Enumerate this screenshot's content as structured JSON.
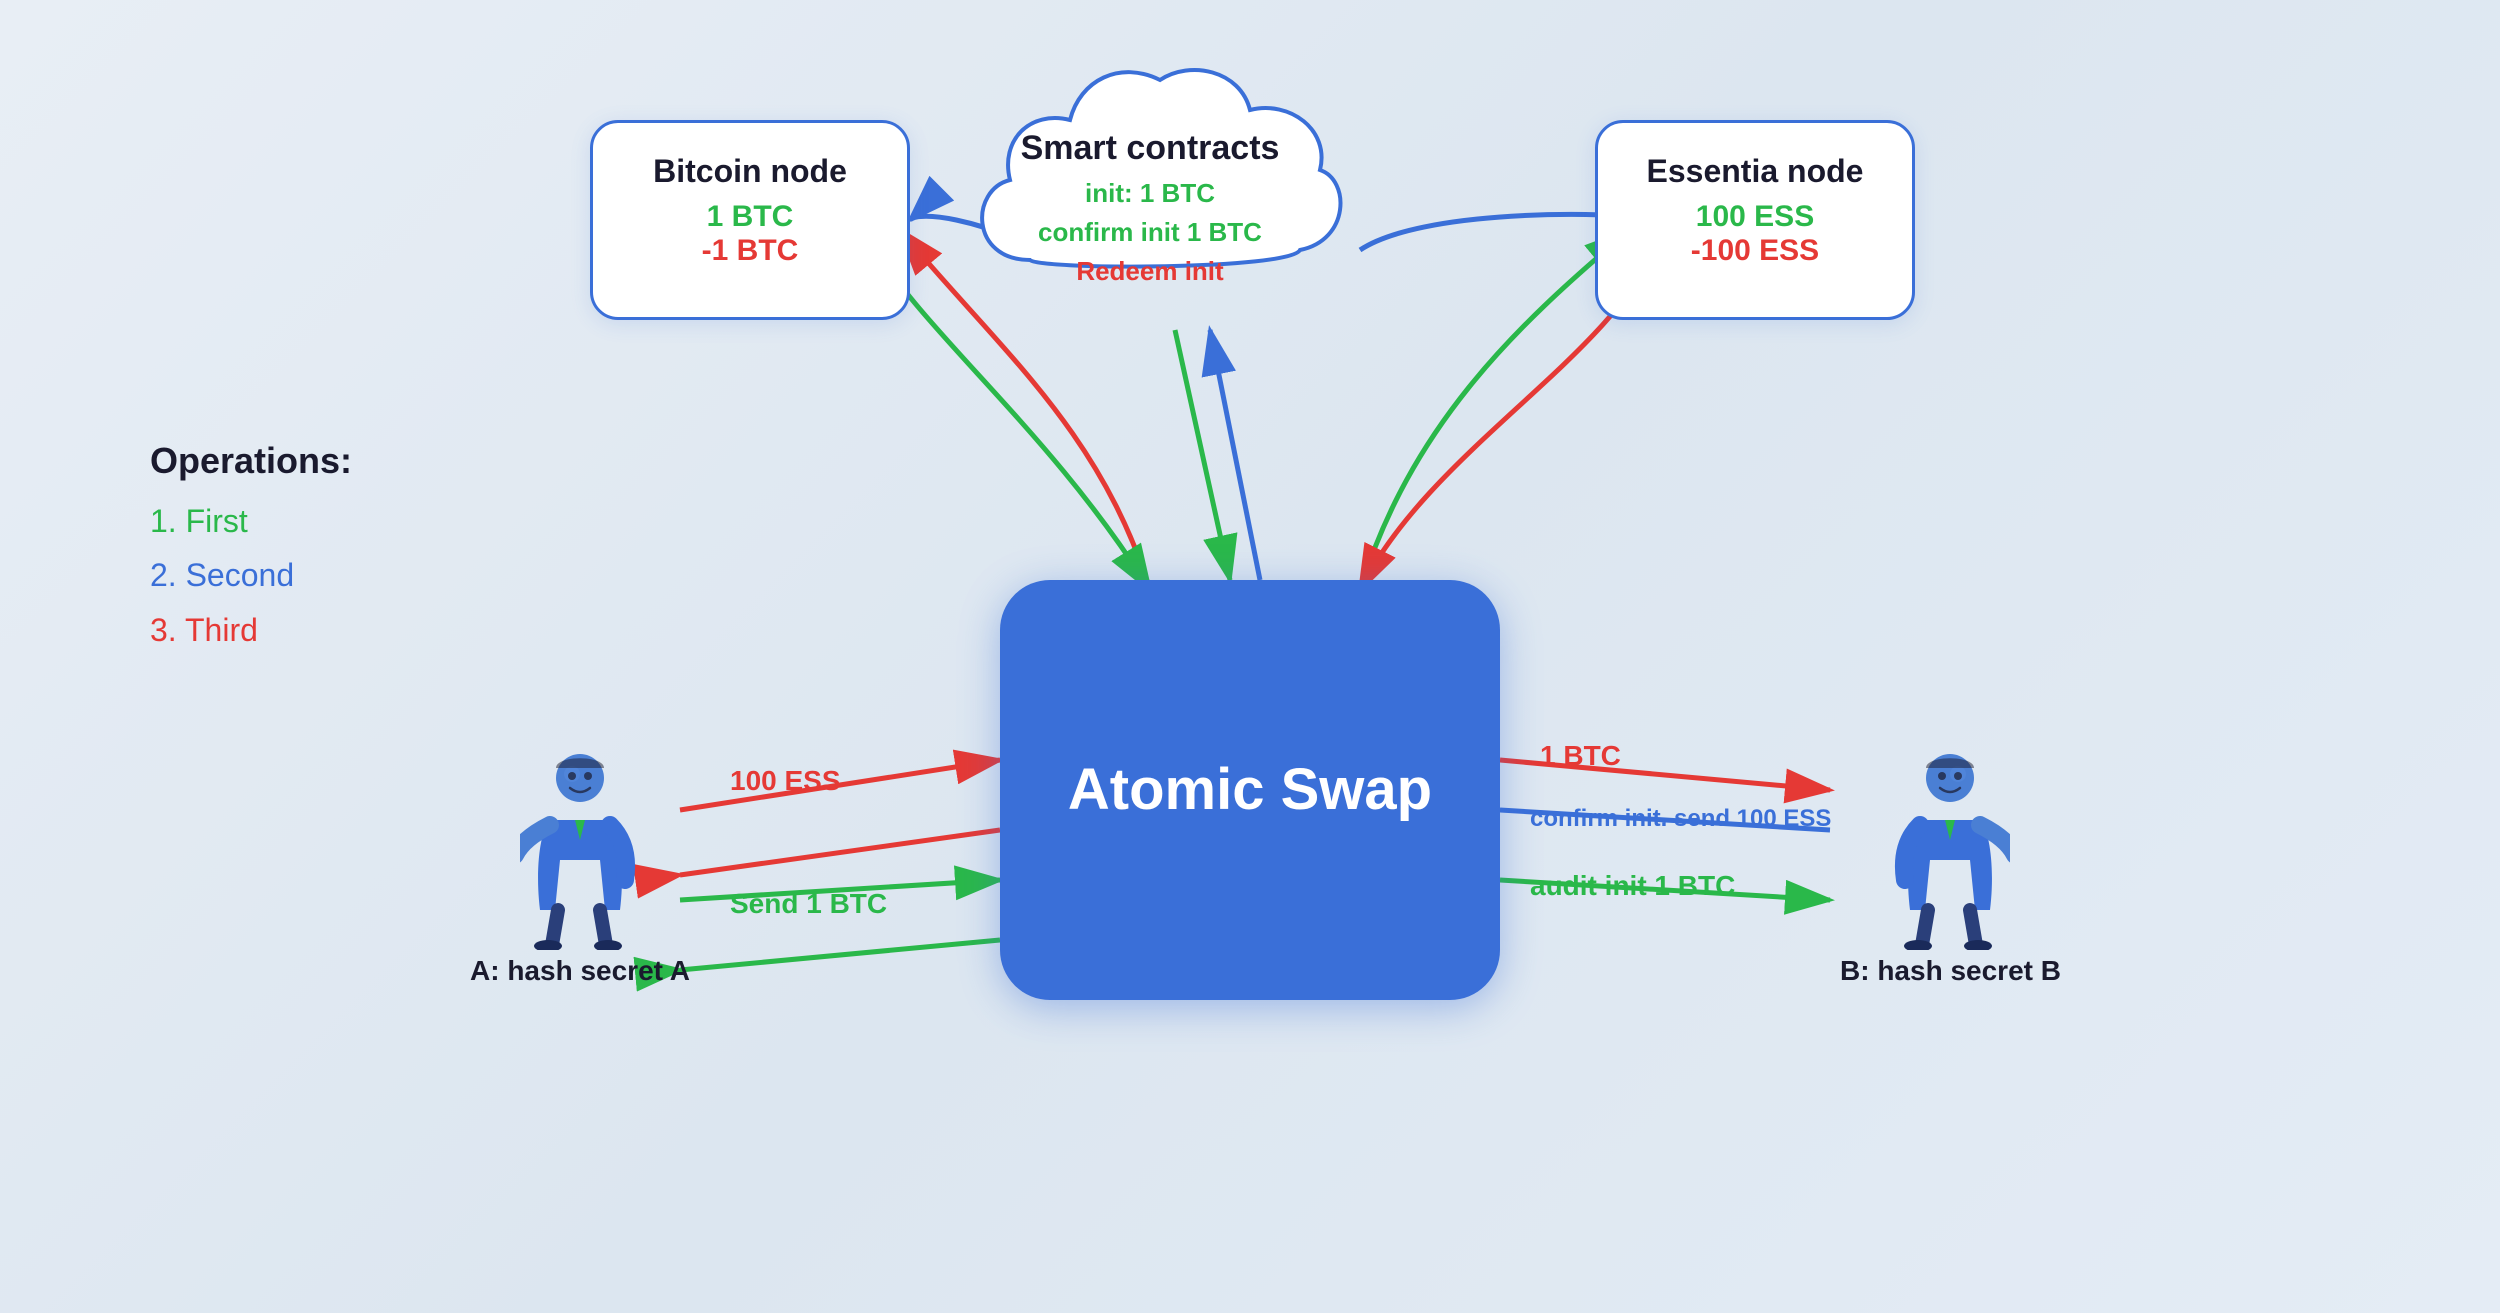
{
  "title": "Atomic Swap Diagram",
  "background_color": "#e8eef5",
  "colors": {
    "blue": "#3a6fd8",
    "green": "#2ab84a",
    "red": "#e53935",
    "dark": "#1a1a2e",
    "white": "#ffffff"
  },
  "bitcoin_node": {
    "title": "Bitcoin node",
    "value1": "1 BTC",
    "value2": "-1 BTC"
  },
  "essentia_node": {
    "title": "Essentia node",
    "value1": "100 ESS",
    "value2": "-100 ESS"
  },
  "smart_contracts": {
    "title": "Smart contracts",
    "line1": "init: 1 BTC",
    "line2": "confirm init 1 BTC",
    "line3": "Redeem init"
  },
  "atomic_swap": {
    "title": "Atomic Swap"
  },
  "operations": {
    "title": "Operations:",
    "op1": "1. First",
    "op2": "2. Second",
    "op3": "3. Third"
  },
  "person_a": {
    "label": "A: hash secret A"
  },
  "person_b": {
    "label": "B: hash secret B"
  },
  "arrows": {
    "ess_to_center": "100 ESS",
    "center_to_a": "",
    "send_btc": "Send 1 BTC",
    "btc_right": "1 BTC",
    "confirm_send": "confirm init. send 100 ESS",
    "audit_btc": "audit init 1 BTC"
  }
}
